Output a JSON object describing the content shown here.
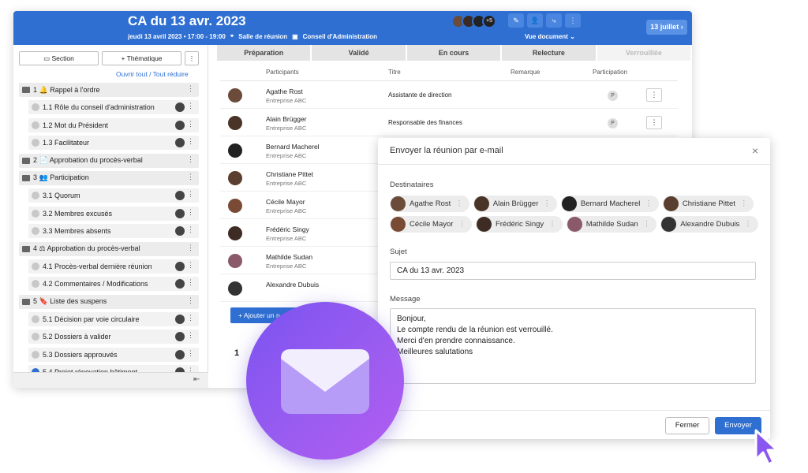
{
  "header": {
    "title": "CA du 13 avr. 2023",
    "date_time": "jeudi 13 avril 2023 • 17:00 - 19:00",
    "room": "Salle de réunion",
    "board": "Conseil d'Administration",
    "avatars_more": "+5",
    "view": "Vue document",
    "next_meeting": "13 juillet"
  },
  "left_panel": {
    "section_btn": "Section",
    "thematic_btn": "+ Thématique",
    "expand_all": "Ouvrir tout",
    "separator": "/",
    "collapse_all": "Tout réduire",
    "items": [
      {
        "type": "section",
        "label": "1 🔔 Rappel à l'ordre"
      },
      {
        "type": "item",
        "label": "1.1 Rôle du conseil d'administration"
      },
      {
        "type": "item",
        "label": "1.2 Mot du Président"
      },
      {
        "type": "item",
        "label": "1.3 Facilitateur"
      },
      {
        "type": "section",
        "label": "2 📄 Approbation du procès-verbal"
      },
      {
        "type": "section",
        "label": "3 👥 Participation"
      },
      {
        "type": "item",
        "label": "3.1 Quorum"
      },
      {
        "type": "item",
        "label": "3.2 Membres excusés"
      },
      {
        "type": "item",
        "label": "3.3 Membres absents"
      },
      {
        "type": "section",
        "label": "4 ⚖ Approbation du procès-verbal"
      },
      {
        "type": "item",
        "label": "4.1 Procès-verbal dernière réunion"
      },
      {
        "type": "item",
        "label": "4.2 Commentaires / Modifications"
      },
      {
        "type": "section",
        "label": "5 🔖 Liste des suspens"
      },
      {
        "type": "item",
        "label": "5.1 Décision par voie circulaire"
      },
      {
        "type": "item",
        "label": "5.2 Dossiers à valider"
      },
      {
        "type": "item",
        "label": "5.3 Dossiers approuvés"
      },
      {
        "type": "item",
        "label": "5.4 Projet rénovation bâtiment"
      }
    ]
  },
  "steps": [
    "Préparation",
    "Validé",
    "En cours",
    "Relecture",
    "Verrouillée"
  ],
  "table": {
    "headers": {
      "participants": "Participants",
      "title": "Titre",
      "remark": "Remarque",
      "participation": "Participation"
    },
    "rows": [
      {
        "name": "Agathe Rost",
        "company": "Entreprise ABC",
        "title": "Assistante de direction",
        "status": "P"
      },
      {
        "name": "Alain Brügger",
        "company": "Entreprise ABC",
        "title": "Responsable des finances",
        "status": "P"
      },
      {
        "name": "Bernard Macherel",
        "company": "Entreprise ABC",
        "title": "",
        "status": ""
      },
      {
        "name": "Christiane Pittet",
        "company": "Entreprise ABC",
        "title": "",
        "status": ""
      },
      {
        "name": "Cécile Mayor",
        "company": "Entreprise ABC",
        "title": "",
        "status": ""
      },
      {
        "name": "Frédéric Singy",
        "company": "Entreprise ABC",
        "title": "",
        "status": ""
      },
      {
        "name": "Mathilde Sudan",
        "company": "Entreprise ABC",
        "title": "",
        "status": ""
      },
      {
        "name": "Alexandre Dubuis",
        "company": "",
        "title": "",
        "status": ""
      }
    ],
    "add_btn": "+ Ajouter un n",
    "below_item": "1"
  },
  "modal": {
    "title": "Envoyer la réunion par e-mail",
    "close_icon": "×",
    "recipients_label": "Destinataires",
    "recipients": [
      "Agathe Rost",
      "Alain Brügger",
      "Bernard Macherel",
      "Christiane Pittet",
      "Cécile Mayor",
      "Frédéric Singy",
      "Mathilde Sudan",
      "Alexandre Dubuis"
    ],
    "subject_label": "Sujet",
    "subject": "CA du 13 avr. 2023",
    "message_label": "Message",
    "message_lines": [
      "Bonjour,",
      "Le compte rendu de la réunion est verrouillé.",
      "Merci d'en prendre connaissance.",
      "Meilleures salutations"
    ],
    "close_btn": "Fermer",
    "send_btn": "Envoyer"
  }
}
